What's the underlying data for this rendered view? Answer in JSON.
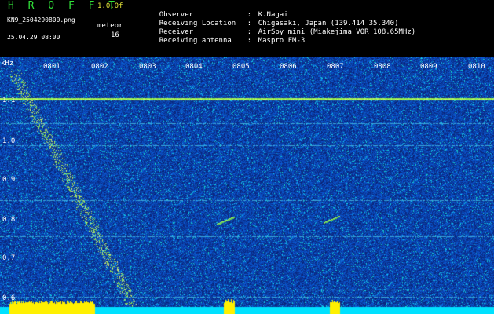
{
  "app": {
    "title": "H R O F F T",
    "version": "1.0.0f"
  },
  "file": {
    "name": "KN9_2504290800.png",
    "timestamp": "25.04.29 08:00"
  },
  "meteor": {
    "label": "meteor",
    "count": "16"
  },
  "info": [
    {
      "key": "Observer",
      "value": "K.Nagai"
    },
    {
      "key": "Receiving Location",
      "value": "Chigasaki, Japan (139.414 35.340)"
    },
    {
      "key": "Receiver",
      "value": "AirSpy mini (Miakejima VOR 108.65MHz)"
    },
    {
      "key": "Receiving antenna",
      "value": "Maspro FM-3"
    }
  ],
  "axes": {
    "y_unit": "kHz",
    "y_ticks": [
      "1.1",
      "1.0",
      "0.9",
      "0.8",
      "0.7",
      "0.6"
    ],
    "x_ticks": [
      "0801",
      "0802",
      "0803",
      "0804",
      "0805",
      "0806",
      "0807",
      "0808",
      "0809",
      "0810"
    ]
  },
  "colors": {
    "background": "#000000",
    "title": "#31e23a",
    "version": "#e8e83a",
    "spectrogram_base": "#0a2a8a",
    "carrier_line": "#b8f050",
    "meteor_trail": "#d0ff70",
    "power_bar": "#00e5ff",
    "power_peak": "#ffff00"
  }
}
